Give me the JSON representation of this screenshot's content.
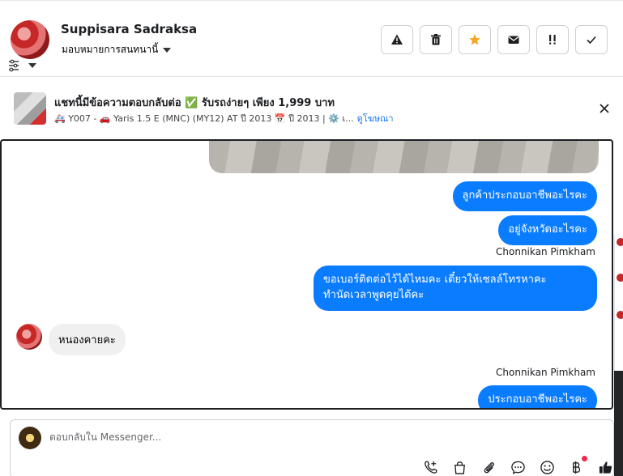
{
  "header": {
    "name": "Suppisara Sadraksa",
    "assign_label": "มอบหมายการสนทนานี้",
    "actions": [
      "spam",
      "delete",
      "star",
      "mark-unread",
      "follow-up",
      "done"
    ]
  },
  "ad": {
    "title": "แชทนี้มีข้อความตอบกลับต่อ ✅ รับรถง่ายๆ เพียง 1,999 บาท",
    "subtitle": "🚑 Y007 - 🚗 Yaris 1.5 E (MNC) (MY12) AT ปี 2013 📅 ปี 2013 | ⚙️ เ...",
    "link": "ดูโฆษณา"
  },
  "messages": {
    "out1": "ลูกค้าประกอบอาชีพอะไรคะ",
    "out2": "อยู่จังหวัดอะไรคะ",
    "sender1": "Chonnikan Pimkham",
    "out3_line1": "ขอเบอร์ติดต่อไว้ได้ไหมคะ เดี๋ยวให้เซลล์โทรหาคะ",
    "out3_line2": "ทำนัดเวลาพูดคุยได้คะ",
    "in1": "หนองคายคะ",
    "sender2": "Chonnikan Pimkham",
    "out4": "ประกอบอาชีพอะไรคะ"
  },
  "composer": {
    "placeholder": "ตอบกลับใน Messenger..."
  },
  "colors": {
    "bubble_out": "#0a7cff",
    "bubble_in": "#f0f0f0",
    "star": "#f5a623"
  }
}
